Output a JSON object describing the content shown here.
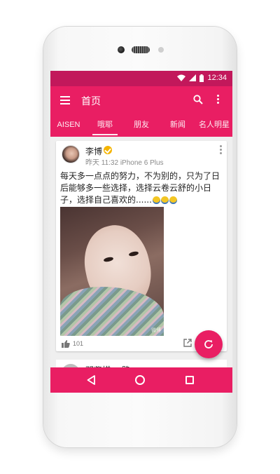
{
  "status_bar": {
    "time": "12:34"
  },
  "app_bar": {
    "title": "首页",
    "menu_icon": "hamburger-menu-icon",
    "search_icon": "search-icon",
    "more_icon": "more-vert-icon"
  },
  "tabs": [
    {
      "label": "AISEN",
      "active": false
    },
    {
      "label": "哦耶",
      "active": true
    },
    {
      "label": "朋友",
      "active": false
    },
    {
      "label": "新闻",
      "active": false
    },
    {
      "label": "名人明星",
      "active": false
    }
  ],
  "post": {
    "user_name": "李博",
    "meta": "昨天 11:32 iPhone 6 Plus",
    "text": "每天多一点点的努力，不为别的，只为了日后能够多一些选择，选择云卷云舒的小日子，选择自己喜欢的......",
    "likes": "101",
    "photo_watermark": "微博"
  },
  "next_post": {
    "user_name": "邓紫棋 一路"
  },
  "colors": {
    "primary": "#e91e63",
    "primary_dark": "#c2185b"
  }
}
